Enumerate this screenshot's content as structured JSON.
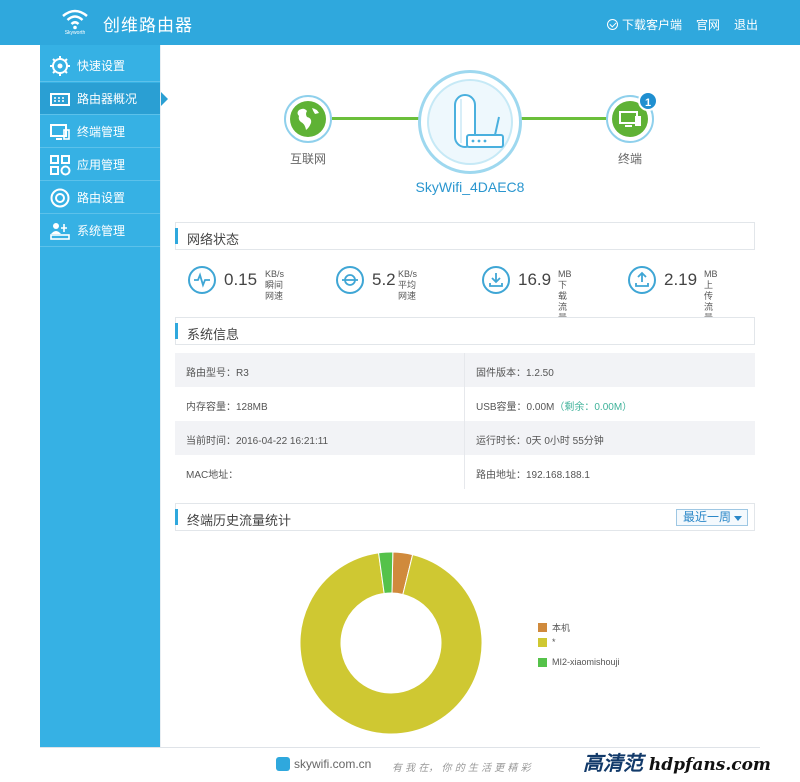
{
  "header": {
    "logo_text": "Skyworth",
    "title": "创维路由器",
    "links": {
      "download": "下载客户端",
      "official": "官网",
      "logout": "退出"
    }
  },
  "sidebar": {
    "items": [
      {
        "label": "快速设置",
        "icon": "gear-icon",
        "active": false
      },
      {
        "label": "路由器概况",
        "icon": "router-overview-icon",
        "active": true
      },
      {
        "label": "终端管理",
        "icon": "monitor-icon",
        "active": false
      },
      {
        "label": "应用管理",
        "icon": "apps-grid-icon",
        "active": false
      },
      {
        "label": "路由设置",
        "icon": "settings-cog-icon",
        "active": false
      },
      {
        "label": "系统管理",
        "icon": "system-admin-icon",
        "active": false
      }
    ]
  },
  "topology": {
    "internet_label": "互联网",
    "terminal_label": "终端",
    "router_name": "SkyWifi_4DAEC8",
    "terminal_count": "1",
    "line_color": "#6bbf3b"
  },
  "network_status": {
    "title": "网络状态",
    "stats": [
      {
        "value": "0.15",
        "unit": "KB/s",
        "label": "瞬间网速",
        "icon": "pulse-icon"
      },
      {
        "value": "5.2",
        "unit": "KB/s",
        "label": "平均网速",
        "icon": "gauge-icon"
      },
      {
        "value": "16.9",
        "unit": "MB",
        "label": "下载流量",
        "icon": "download-icon"
      },
      {
        "value": "2.19",
        "unit": "MB",
        "label": "上传流量",
        "icon": "upload-icon"
      }
    ]
  },
  "system_info": {
    "title": "系统信息",
    "rows": [
      {
        "left": "路由型号：R3",
        "right": "固件版本：1.2.50"
      },
      {
        "left": "内存容量：128MB",
        "right": "USB容量：0.00M",
        "right_extra": "（剩余：0.00M）"
      },
      {
        "left": "当前时间：2016-04-22 16:21:11",
        "right": "运行时长：0天 0小时 55分钟"
      },
      {
        "left": "MAC地址：",
        "right": "路由地址：192.168.188.1"
      }
    ]
  },
  "history": {
    "title": "终端历史流量统计",
    "range_select": "最近一周"
  },
  "chart_data": {
    "type": "pie",
    "style": "donut",
    "labels": [
      "本机",
      "*",
      "MI2-xiaomishouji"
    ],
    "values": [
      3.5,
      94.0,
      2.5
    ],
    "colors": [
      "#d08a3c",
      "#cfc832",
      "#55c24a"
    ],
    "legend_position": "right"
  },
  "footer": {
    "site": "skywifi.com.cn",
    "slogan": "有 我 在，  你 的 生 活 更 精 彩",
    "watermark_cn": "高清范",
    "watermark_en": "hdpfans.com"
  }
}
